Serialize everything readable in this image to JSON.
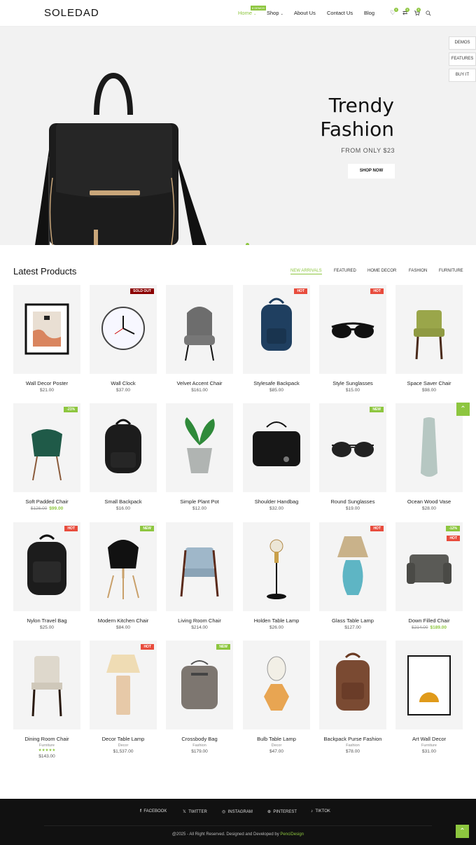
{
  "header": {
    "logo": "SOLEDAD",
    "nav": [
      {
        "label": "Home",
        "active": true
      },
      {
        "label": "Shop"
      },
      {
        "label": "About Us"
      },
      {
        "label": "Contact Us"
      },
      {
        "label": "Blog"
      }
    ],
    "home_badge": "8 DEMOS",
    "wishlist_count": "0",
    "compare_count": "0",
    "cart_count": "0"
  },
  "hero": {
    "title_line1": "Trendy",
    "title_line2": "Fashion",
    "subtitle": "FROM ONLY $23",
    "button": "SHOP NOW"
  },
  "side_tabs": [
    "DEMOS",
    "FEATURES",
    "BUY IT"
  ],
  "products_section": {
    "title": "Latest Products",
    "tabs": [
      "NEW ARRIVALS",
      "FEATURED",
      "HOME DECOR",
      "FASHION",
      "FURNITURE"
    ]
  },
  "products": [
    {
      "name": "Wall Decor Poster",
      "price": "$21.00"
    },
    {
      "name": "Wall Clock",
      "price": "$37.00",
      "tag": "SOLD OUT"
    },
    {
      "name": "Velvet Accent Chair",
      "price": "$161.00"
    },
    {
      "name": "Stylesafe Backpack",
      "price": "$85.00",
      "tag": "HOT"
    },
    {
      "name": "Style Sunglasses",
      "price": "$15.00",
      "tag": "HOT"
    },
    {
      "name": "Space Saver Chair",
      "price": "$98.00"
    },
    {
      "name": "Soft Padded Chair",
      "old_price": "$126.00",
      "price": "$99.00",
      "tag": "-21%"
    },
    {
      "name": "Small Backpack",
      "price": "$16.00"
    },
    {
      "name": "Simple Plant Pot",
      "price": "$12.00"
    },
    {
      "name": "Shoulder Handbag",
      "price": "$32.00"
    },
    {
      "name": "Round Sunglasses",
      "price": "$19.00",
      "tag": "NEW"
    },
    {
      "name": "Ocean Wood Vase",
      "price": "$28.00"
    },
    {
      "name": "Nylon Travel Bag",
      "price": "$25.00",
      "tag": "HOT"
    },
    {
      "name": "Modern Kitchen Chair",
      "price": "$84.00",
      "tag": "NEW"
    },
    {
      "name": "Living Room Chair",
      "price": "$214.00"
    },
    {
      "name": "Holden Table Lamp",
      "price": "$26.00"
    },
    {
      "name": "Glass Table Lamp",
      "price": "$127.00",
      "tag": "HOT"
    },
    {
      "name": "Down Filled Chair",
      "old_price": "$214.00",
      "price": "$189.00",
      "tag": "-12%",
      "tag2": "HOT"
    },
    {
      "name": "Dining Room Chair",
      "category": "Furniture",
      "rating": 5,
      "price": "$143.00"
    },
    {
      "name": "Decor Table Lamp",
      "category": "Decor",
      "price": "$1,537.00",
      "tag": "HOT"
    },
    {
      "name": "Crossbody Bag",
      "category": "Fashion",
      "price": "$179.00",
      "tag": "NEW"
    },
    {
      "name": "Bulb Table Lamp",
      "category": "Decor",
      "price": "$47.00"
    },
    {
      "name": "Backpack Purse Fashion",
      "category": "Fashion",
      "price": "$78.00"
    },
    {
      "name": "Art Wall Decor",
      "category": "Furniture",
      "price": "$31.00"
    }
  ],
  "footer": {
    "social": [
      "FACEBOOK",
      "TWITTER",
      "INSTAGRAM",
      "PINTEREST",
      "TIKTOK"
    ],
    "copyright_prefix": "@2025 - All Right Reserved. Designed and Developed by ",
    "copyright_brand": "PenciDesign"
  },
  "colors": {
    "accent": "#8dc63f",
    "hot": "#e84c3d",
    "sold_out": "#8b0000",
    "footer_bg": "#111111"
  }
}
